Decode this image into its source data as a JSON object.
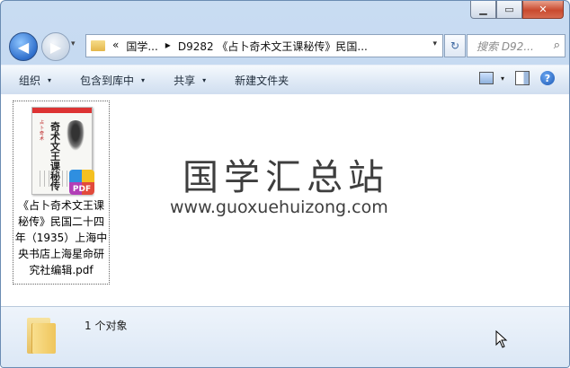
{
  "window": {
    "caption_buttons": [
      "minimize",
      "maximize",
      "close"
    ]
  },
  "nav": {
    "back_glyph": "◀",
    "forward_glyph": "▶",
    "history_glyph": "▾",
    "breadcrumb": [
      "«",
      "国学...",
      "▸",
      "D9282 《占卜奇术文王课秘传》民国..."
    ],
    "address_dropdown_glyph": "▾",
    "refresh_glyph": "↻",
    "search_placeholder": "搜索 D92...",
    "search_glyph": "⌕"
  },
  "toolbar": {
    "items": [
      "组织",
      "包含到库中",
      "共享",
      "新建文件夹"
    ],
    "dropdown_glyph": "▾",
    "help_glyph": "?"
  },
  "file": {
    "name": "《占卜奇术文王课秘传》民国二十四年（1935）上海中央书店上海星命研究社编辑.pdf",
    "thumb_title": "奇术文王课秘传",
    "thumb_side_text": "占卜奇术",
    "badge": "PDF"
  },
  "watermark": {
    "title": "国学汇总站",
    "url": "www.guoxuehuizong.com"
  },
  "details": {
    "count": "1 个对象"
  },
  "colors": {
    "accent": "#2f6fcc",
    "toolbar_bg": "#dde8f5",
    "close_red": "#c94a2f"
  },
  "icons": [
    "folder-icon",
    "back-arrow-icon",
    "forward-arrow-icon",
    "refresh-icon",
    "search-icon",
    "view-icon",
    "preview-pane-icon",
    "help-icon",
    "pdf-icon",
    "mouse-cursor-icon"
  ]
}
